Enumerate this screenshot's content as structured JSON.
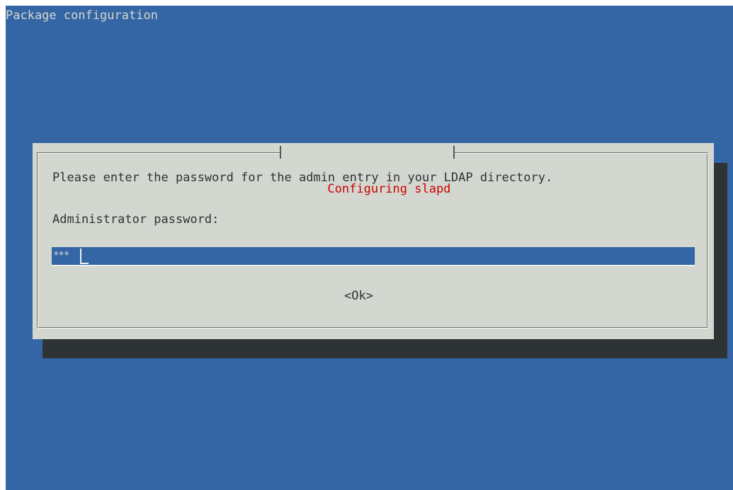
{
  "window": {
    "backtitle": "Package configuration"
  },
  "dialog": {
    "title": "Configuring slapd",
    "prompt": "Please enter the password for the admin entry in your LDAP directory.",
    "field_label": "Administrator password:",
    "password_value": "***",
    "ok_label": "<Ok>"
  },
  "colors": {
    "background": "#3465a4",
    "dialog": "#d3d7cf",
    "title_text": "#cc0000",
    "shadow": "#2e3436"
  }
}
